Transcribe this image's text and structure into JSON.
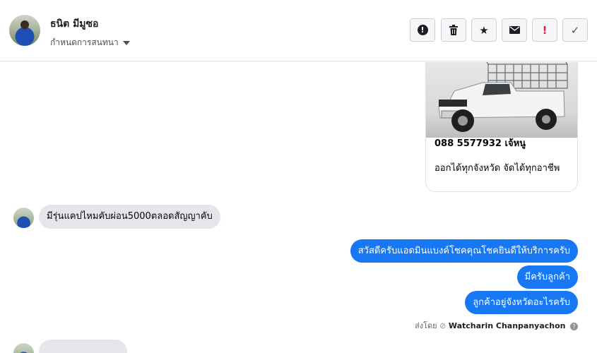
{
  "header": {
    "contact_name": "ธนิต มีมูซอ",
    "assign_label": "กำหนดการสนทนา",
    "tools": [
      {
        "name": "alert-circle-icon",
        "glyph": "!"
      },
      {
        "name": "trash-icon",
        "glyph": "🗑"
      },
      {
        "name": "star-icon",
        "glyph": "★"
      },
      {
        "name": "envelope-icon",
        "glyph": "✉"
      },
      {
        "name": "exclamation-icon",
        "glyph": "!"
      },
      {
        "name": "check-icon",
        "glyph": "✓"
      }
    ]
  },
  "card": {
    "title": "088 5577932 เจ้หนู",
    "description": "ออกได้ทุกจังหวัด จัดได้ทุกอาชีพ"
  },
  "messages": {
    "incoming": "มีรุ่นแคปไหมคับผ่อน5000ตลอดสัญญาคับ",
    "outgoing": [
      "สวัสดีครับแอดมินแบงค์โชคคุณโชคยินดีให้บริการครับ",
      "มีครับลูกค้า",
      "ลูกค้าอยู่จังหวัดอะไรครับ"
    ],
    "sent_by_prefix": "ส่งโดย",
    "sent_by_name": "Watcharin Chanpanyachon"
  },
  "colors": {
    "accent_blue": "#1877f2",
    "incoming_bubble": "#e4e6eb",
    "exclamation_red": "#e41e3f"
  }
}
